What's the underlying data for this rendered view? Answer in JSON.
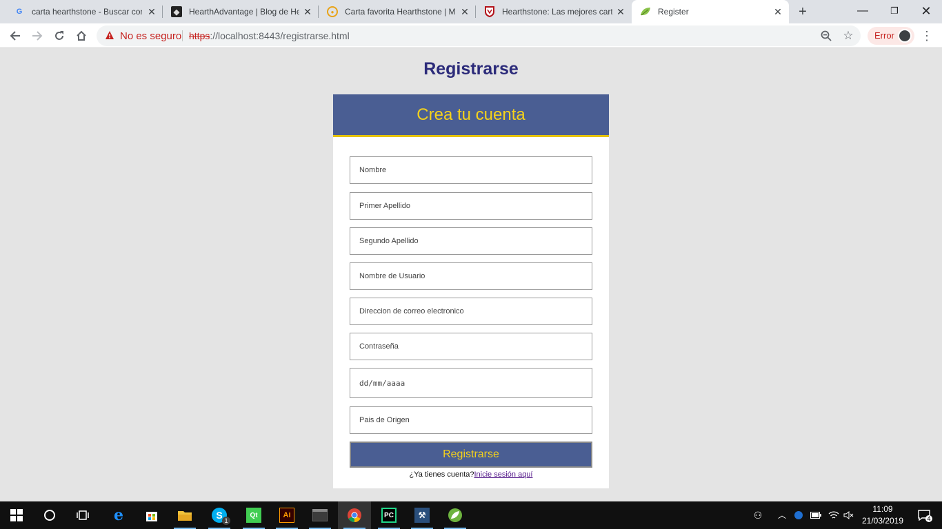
{
  "browser": {
    "tabs": [
      {
        "title": "carta hearthstone - Buscar con Google",
        "favicon": "google-icon"
      },
      {
        "title": "HearthAdvantage | Blog de Hearthstone",
        "favicon": "hearthadvantage-icon"
      },
      {
        "title": "Carta favorita Hearthstone | Meristation",
        "favicon": "meristation-icon"
      },
      {
        "title": "Hearthstone: Las mejores cartas",
        "favicon": "shield-site-icon"
      },
      {
        "title": "Register",
        "favicon": "leaf-icon",
        "active": true
      }
    ],
    "security_label": "No es seguro",
    "url": {
      "scheme": "https",
      "host": "://localhost",
      "rest": ":8443/registrarse.html"
    },
    "error_label": "Error"
  },
  "page": {
    "title": "Registrarse",
    "card_title": "Crea tu cuenta",
    "fields": {
      "nombre": "Nombre",
      "primer_apellido": "Primer Apellido",
      "segundo_apellido": "Segundo Apellido",
      "usuario": "Nombre de Usuario",
      "email": "Direccion de correo electronico",
      "password": "Contraseña",
      "fecha": "dd/mm/aaaa",
      "pais": "Pais de Origen"
    },
    "submit_label": "Registrarse",
    "login_prompt": "¿Ya tienes cuenta?",
    "login_link": "Inicie sesión aquí"
  },
  "taskbar": {
    "time": "11:09",
    "date": "21/03/2019",
    "skype_badge": "1",
    "notification_count": "4",
    "apps": [
      "windows-start-icon",
      "cortana-icon",
      "task-view-icon",
      "edge-icon",
      "store-icon",
      "file-explorer-icon",
      "skype-icon",
      "qt-icon",
      "illustrator-icon",
      "terminal-icon",
      "chrome-icon",
      "pycharm-icon",
      "sql-server-icon",
      "spring-icon"
    ]
  },
  "colors": {
    "brand_blue": "#4a5e93",
    "brand_yellow": "#f5d21b",
    "title_navy": "#2c2b7a"
  }
}
